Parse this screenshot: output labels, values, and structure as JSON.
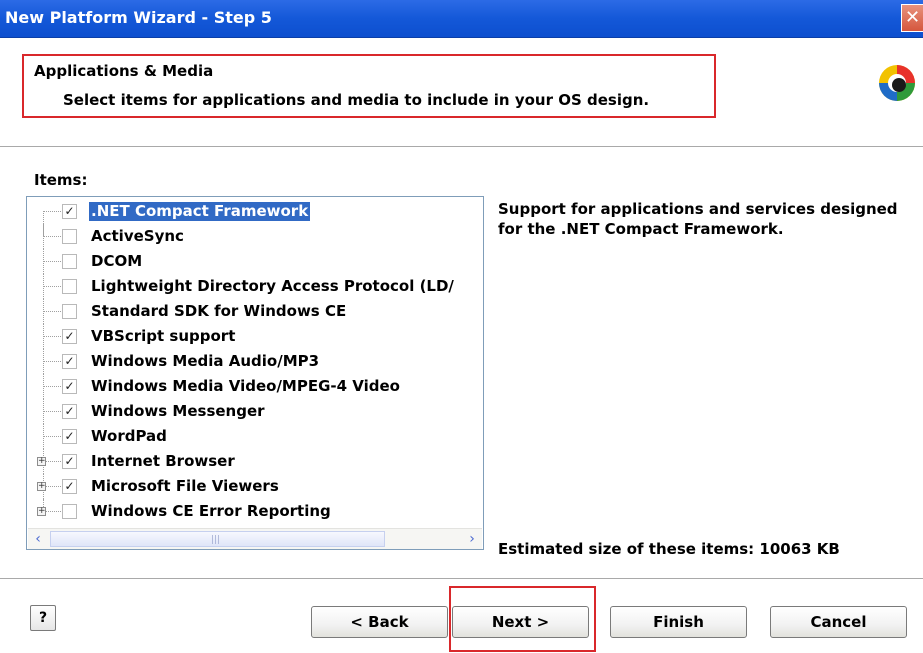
{
  "window": {
    "title": "New Platform Wizard - Step 5",
    "close_glyph": "✕"
  },
  "header": {
    "title": "Applications & Media",
    "subtitle": "Select items for applications and media to include in your OS design.",
    "logo_icon": "platform-builder-logo-icon"
  },
  "items": {
    "label": "Items:",
    "list": [
      {
        "label": ".NET Compact Framework",
        "checked": true,
        "selected": true,
        "expandable": false
      },
      {
        "label": "ActiveSync",
        "checked": false,
        "selected": false,
        "expandable": false
      },
      {
        "label": "DCOM",
        "checked": false,
        "selected": false,
        "expandable": false
      },
      {
        "label": "Lightweight Directory Access Protocol (LD/",
        "checked": false,
        "selected": false,
        "expandable": false
      },
      {
        "label": "Standard SDK for Windows CE",
        "checked": false,
        "selected": false,
        "expandable": false
      },
      {
        "label": "VBScript support",
        "checked": true,
        "selected": false,
        "expandable": false
      },
      {
        "label": "Windows Media Audio/MP3",
        "checked": true,
        "selected": false,
        "expandable": false
      },
      {
        "label": "Windows Media Video/MPEG-4 Video",
        "checked": true,
        "selected": false,
        "expandable": false
      },
      {
        "label": "Windows Messenger",
        "checked": true,
        "selected": false,
        "expandable": false
      },
      {
        "label": "WordPad",
        "checked": true,
        "selected": false,
        "expandable": false
      },
      {
        "label": "Internet Browser",
        "checked": true,
        "selected": false,
        "expandable": true
      },
      {
        "label": "Microsoft File Viewers",
        "checked": true,
        "selected": false,
        "expandable": true
      },
      {
        "label": "Windows CE Error Reporting",
        "checked": false,
        "selected": false,
        "expandable": true
      }
    ],
    "scroll_left_glyph": "‹",
    "scroll_right_glyph": "›",
    "scroll_grip": "|||"
  },
  "description": "Support for applications and services designed for the .NET Compact Framework.",
  "estimated_size": "Estimated size of these items: 10063 KB",
  "buttons": {
    "help": "?",
    "back": "< Back",
    "next": "Next >",
    "finish": "Finish",
    "cancel": "Cancel"
  },
  "colors": {
    "titlebar": "#1458d8",
    "selection": "#316ac5",
    "highlight_box": "#d9282b"
  }
}
